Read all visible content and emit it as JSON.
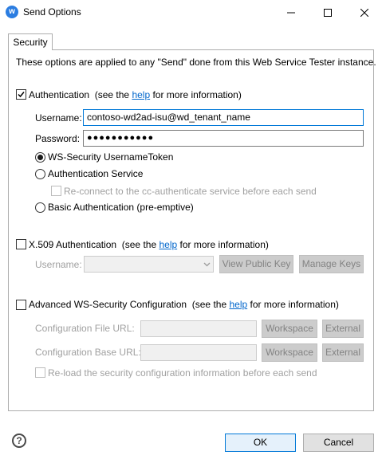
{
  "window": {
    "title": "Send Options",
    "app_icon_letter": "w"
  },
  "tabs": [
    {
      "label": "Security",
      "active": true
    }
  ],
  "security": {
    "intro": "These options are applied to any \"Send\" done from this Web Service Tester instance.",
    "authentication": {
      "label": "Authentication",
      "checked": true,
      "see_prefix": "(see the",
      "help_link": "help",
      "see_suffix": "for more information)",
      "username_label": "Username:",
      "username_value": "contoso-wd2ad-isu@wd_tenant_name",
      "password_label": "Password:",
      "password_value": "●●●●●●●●●●●",
      "options": {
        "ws_security": "WS-Security UsernameToken",
        "auth_service": "Authentication Service",
        "reconnect": "Re-connect to the cc-authenticate service before each send",
        "basic": "Basic Authentication (pre-emptive)"
      }
    },
    "x509": {
      "label": "X.509 Authentication",
      "see_prefix": "(see the",
      "help_link": "help",
      "see_suffix": "for more information)",
      "username_label": "Username:",
      "username_value": "",
      "view_key_label": "View Public Key",
      "manage_keys_label": "Manage Keys"
    },
    "advanced": {
      "label": "Advanced WS-Security Configuration",
      "see_prefix": "(see the",
      "help_link": "help",
      "see_suffix": "for more information)",
      "config_file_label": "Configuration File URL:",
      "config_base_label": "Configuration Base URL:",
      "workspace_label": "Workspace",
      "external_label": "External",
      "reload_label": "Re-load the security configuration information before each send"
    }
  },
  "footer": {
    "help_glyph": "?",
    "ok_label": "OK",
    "cancel_label": "Cancel"
  },
  "colors": {
    "link": "#0066cc",
    "focus_border": "#0078d7",
    "app_icon": "#2b7de1"
  }
}
